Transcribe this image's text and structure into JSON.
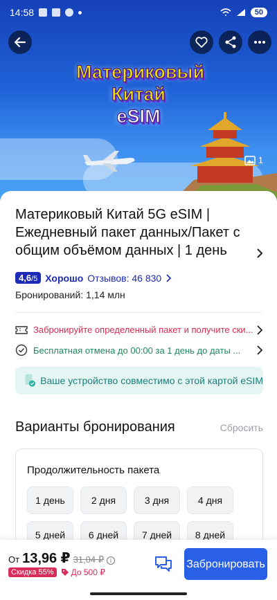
{
  "status_bar": {
    "time": "14:58",
    "battery": "50"
  },
  "hero": {
    "title_lines": [
      "Материковый",
      "Китай",
      "eSIM"
    ],
    "photo_count": "1",
    "icons": [
      "back-arrow-icon",
      "heart-icon",
      "share-icon",
      "more-icon",
      "image-icon"
    ]
  },
  "product": {
    "title": "Материковый Китай 5G eSIM | Ежедневный пакет данных/Пакет с общим объёмом данных | 1 день",
    "rating_value": "4,6",
    "rating_scale": "/5",
    "rating_word": "Хорошо",
    "reviews_label": "Отзывов: 46 830",
    "bookings": "Бронирований: 1,14 млн"
  },
  "promo": {
    "text": "Забронируйте определенный пакет и получите ски...",
    "cancel_text": "Бесплатная отмена до 00:00 за 1 день до даты ..."
  },
  "compat": {
    "text": "Ваше устройство совместимо с этой картой eSIM"
  },
  "options": {
    "section_title": "Варианты бронирования",
    "reset": "Сбросить",
    "duration_title": "Продолжительность пакета",
    "durations": [
      "1 день",
      "2 дня",
      "3 дня",
      "4 дня",
      "5 дней",
      "6 дней",
      "7 дней",
      "8 дней"
    ]
  },
  "bottom": {
    "from_label": "От",
    "price": "13,96 ₽",
    "old_price": "31,04 ₽",
    "discount": "Скидка 55%",
    "upto": "До 500 ₽",
    "book_label": "Забронировать"
  },
  "colors": {
    "accent": "#2a5fe8",
    "rating": "#1b2bb8",
    "promo": "#d92b4f",
    "cancel": "#1e8a5c",
    "compat_bg": "#e4f5f3"
  }
}
